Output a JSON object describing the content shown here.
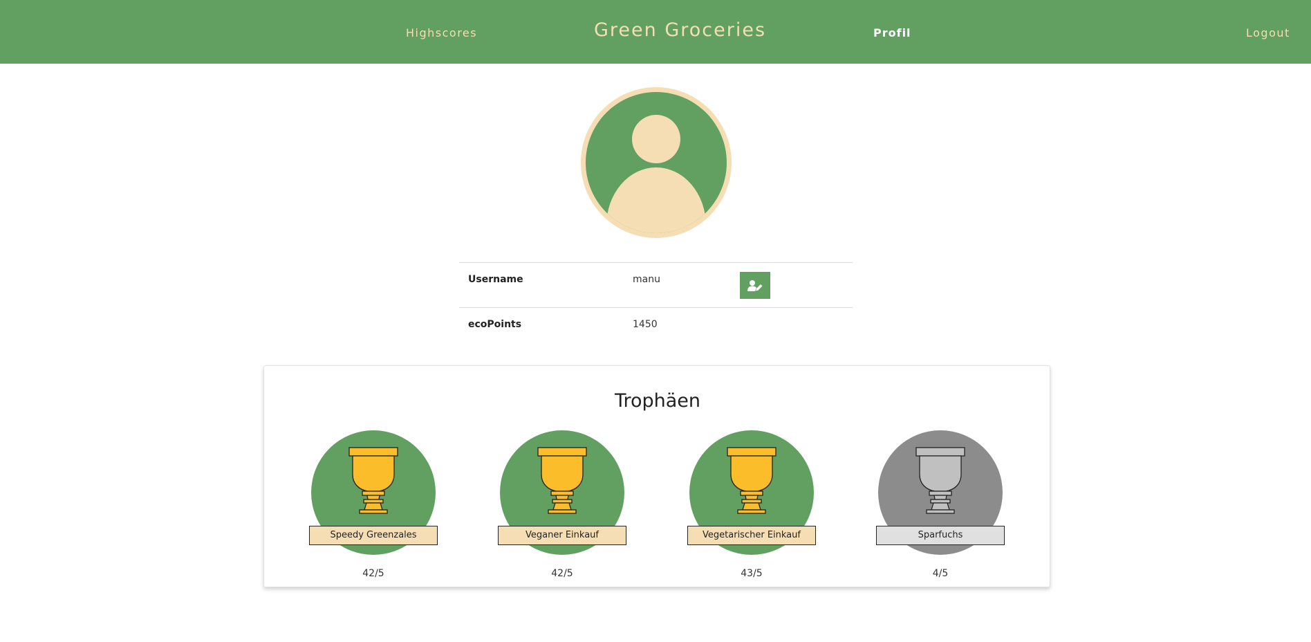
{
  "nav": {
    "highscores": "Highscores",
    "brand": "Green Groceries",
    "profil": "Profil",
    "logout": "Logout"
  },
  "profile": {
    "avatar_icon": "user-avatar-icon",
    "rows": [
      {
        "label": "Username",
        "value": "manu"
      },
      {
        "label": "ecoPoints",
        "value": "1450"
      }
    ],
    "edit_icon": "user-edit-icon"
  },
  "trophies": {
    "title": "Trophäen",
    "items": [
      {
        "name": "Speedy Greenzales",
        "progress": "42/5",
        "earned": true
      },
      {
        "name": "Veganer Einkauf",
        "progress": "42/5",
        "earned": true
      },
      {
        "name": "Vegetarischer Einkauf",
        "progress": "43/5",
        "earned": true
      },
      {
        "name": "Sparfuchs",
        "progress": "4/5",
        "earned": false
      }
    ]
  },
  "colors": {
    "primary_green": "#61a061",
    "wheat": "#f5deb3",
    "trophy_gold": "#fbbd29",
    "trophy_gray_bg": "#8c8c8c",
    "trophy_gray_cup": "#c0c0c0",
    "label_gray": "#e0e0e0"
  }
}
